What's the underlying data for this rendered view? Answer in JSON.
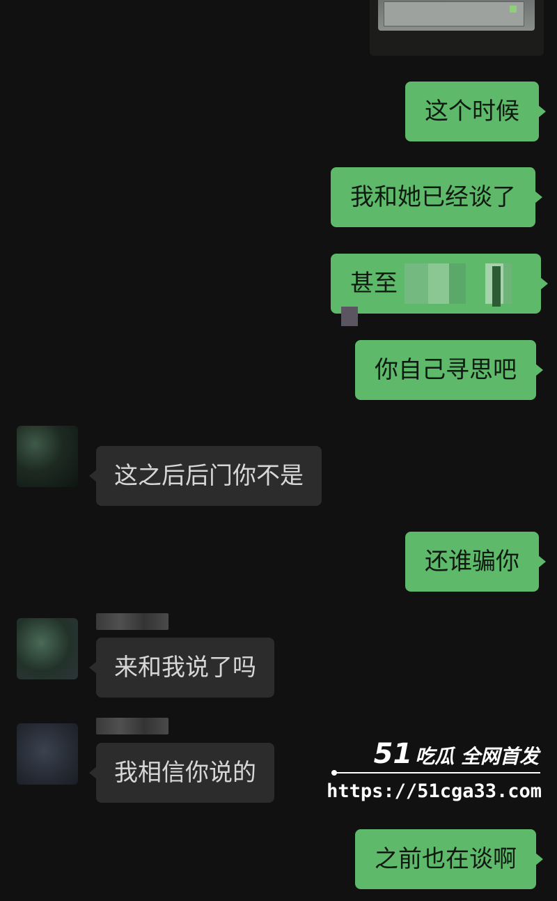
{
  "colors": {
    "background": "#111111",
    "outgoing_bubble": "#5eb96a",
    "incoming_bubble": "#2c2c2c"
  },
  "messages": [
    {
      "side": "out",
      "text": "这个时候"
    },
    {
      "side": "out",
      "text": "我和她已经谈了"
    },
    {
      "side": "out",
      "text": "甚至"
    },
    {
      "side": "out",
      "text": "你自己寻思吧"
    },
    {
      "side": "in",
      "text": "这之后后门你不是"
    },
    {
      "side": "out",
      "text": "还谁骗你"
    },
    {
      "side": "in",
      "text": "来和我说了吗"
    },
    {
      "side": "in",
      "text": "我相信你说的"
    },
    {
      "side": "out",
      "text": "之前也在谈啊"
    }
  ],
  "watermark": {
    "brand_number": "51",
    "brand_text": "吃瓜 全网首发",
    "url": "https://51cga33.com"
  }
}
